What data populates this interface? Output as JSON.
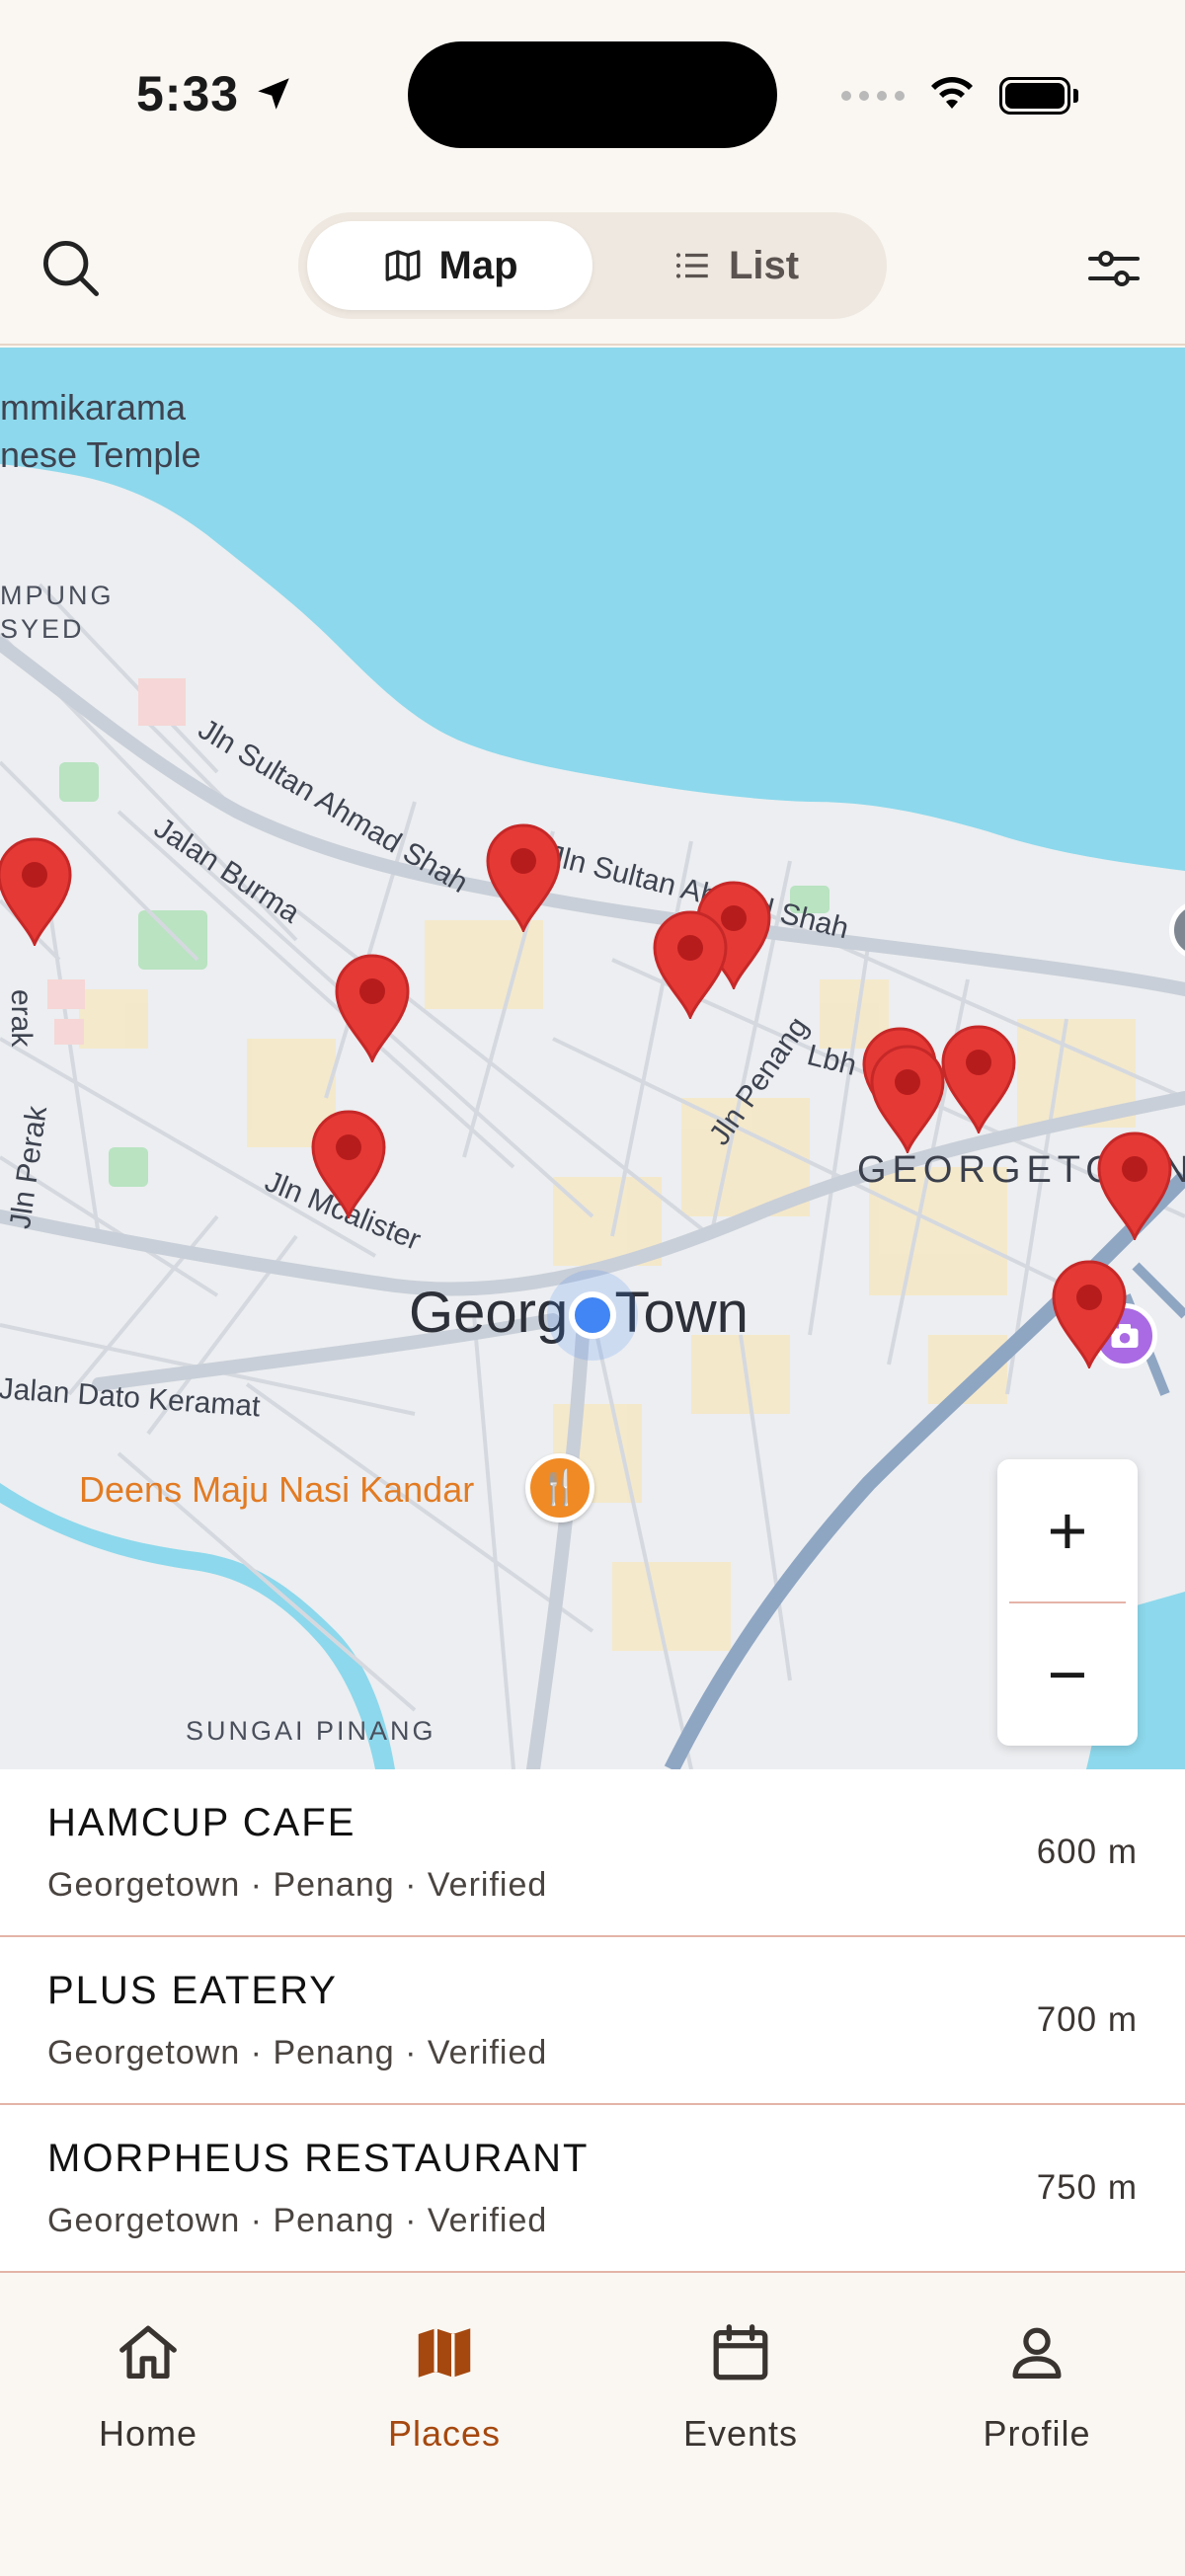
{
  "status_bar": {
    "time": "5:33"
  },
  "header": {
    "segments": [
      {
        "label": "Map",
        "icon": "map-icon",
        "active": true
      },
      {
        "label": "List",
        "icon": "list-icon",
        "active": false
      }
    ]
  },
  "map": {
    "labels": {
      "temple_1": "mmikarama",
      "temple_2": "nese Temple",
      "kampung_1": "MPUNG",
      "kampung_2": "SYED",
      "sultan_1": "Jln Sultan Ahmad Shah",
      "sultan_2": "Jln Sultan Ahmad Shah",
      "burma": "Jalan Burma",
      "perak_1": "Jln Perak",
      "perak_2": "erak",
      "penang": "Jln Penang",
      "lbh": "Lbh",
      "mcalister": "Jln Mcalister",
      "city": "George Town",
      "district": "GEORGETOWN",
      "dato": "Jalan Dato Keramat",
      "sungai": "SUNGAI PINANG",
      "poi": "Deens Maju Nasi Kandar"
    },
    "zoom_in": "+",
    "zoom_out": "−",
    "accent": "#E53935"
  },
  "places": [
    {
      "name": "HAMCUP CAFE",
      "meta": "Georgetown · Penang · Verified",
      "distance": "600 m"
    },
    {
      "name": "PLUS EATERY",
      "meta": "Georgetown · Penang · Verified",
      "distance": "700 m"
    },
    {
      "name": "MORPHEUS RESTAURANT",
      "meta": "Georgetown · Penang · Verified",
      "distance": "750 m"
    }
  ],
  "nav": [
    {
      "label": "Home",
      "icon": "home-icon",
      "active": false
    },
    {
      "label": "Places",
      "icon": "map-icon",
      "active": true
    },
    {
      "label": "Events",
      "icon": "calendar-icon",
      "active": false
    },
    {
      "label": "Profile",
      "icon": "person-icon",
      "active": false
    }
  ],
  "colors": {
    "brand": "#A5480F",
    "pin": "#E53935",
    "water": "#8DD8EC",
    "background": "#FAF7F2"
  }
}
